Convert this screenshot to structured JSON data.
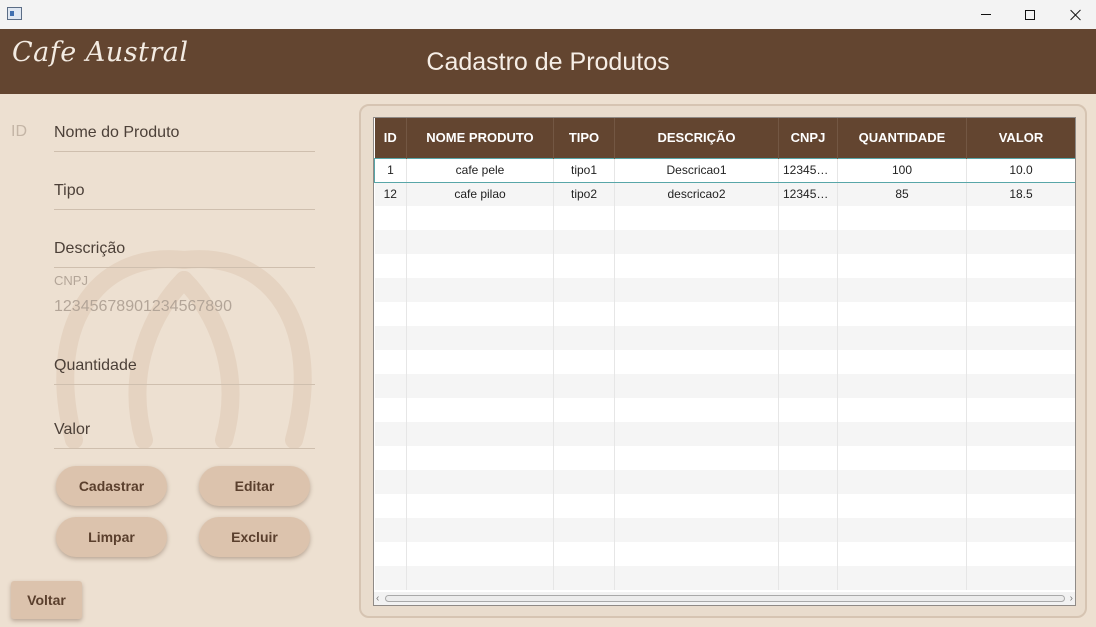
{
  "window": {
    "controls": [
      "minimize",
      "maximize",
      "close"
    ]
  },
  "header": {
    "logo_text": "Cafe Austral",
    "title": "Cadastro de Produtos"
  },
  "form": {
    "id_label": "ID",
    "nome_label": "Nome do Produto",
    "tipo_label": "Tipo",
    "descricao_label": "Descrição",
    "cnpj_caption": "CNPJ",
    "cnpj_value": "12345678901234567890",
    "quantidade_label": "Quantidade",
    "valor_label": "Valor"
  },
  "buttons": {
    "cadastrar": "Cadastrar",
    "editar": "Editar",
    "limpar": "Limpar",
    "excluir": "Excluir",
    "voltar": "Voltar"
  },
  "table": {
    "columns": [
      "ID",
      "NOME PRODUTO",
      "TIPO",
      "DESCRIÇÃO",
      "CNPJ",
      "QUANTIDADE",
      "VALOR"
    ],
    "rows": [
      [
        "1",
        "cafe pele",
        "tipo1",
        "Descricao1",
        "123456...",
        "100",
        "10.0"
      ],
      [
        "12",
        "cafe pilao",
        "tipo2",
        "descricao2",
        "123456...",
        "85",
        "18.5"
      ]
    ],
    "selected_row": 0,
    "empty_rows": 16
  },
  "colors": {
    "brown": "#634530",
    "beige": "#ede0d1",
    "button": "#dcc3ad"
  }
}
